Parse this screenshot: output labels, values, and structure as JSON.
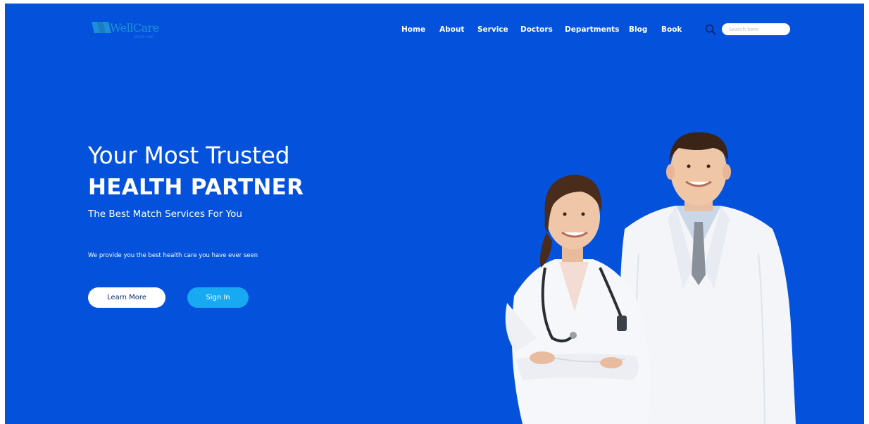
{
  "brand": {
    "name": "WellCare",
    "tagline": "HEALTH CARE",
    "logo_color": "#1d8fd8"
  },
  "nav": {
    "items": [
      {
        "label": "Home"
      },
      {
        "label": "About"
      },
      {
        "label": "Service"
      },
      {
        "label": "Doctors"
      },
      {
        "label": "Departments"
      },
      {
        "label": "Blog"
      },
      {
        "label": "Book"
      }
    ]
  },
  "search": {
    "icon": "search-icon",
    "placeholder": "Search here"
  },
  "hero": {
    "line1": "Your Most Trusted",
    "line2": "HEALTH PARTNER",
    "line3": "The Best Match Services For You",
    "description": "We provide you the best health care you have ever seen",
    "image": "doctors-photo"
  },
  "buttons": {
    "learn_more": "Learn More",
    "sign_in": "Sign In"
  },
  "colors": {
    "background": "#0452db",
    "accent_button": "#17a9f2",
    "text": "#ffffff"
  }
}
